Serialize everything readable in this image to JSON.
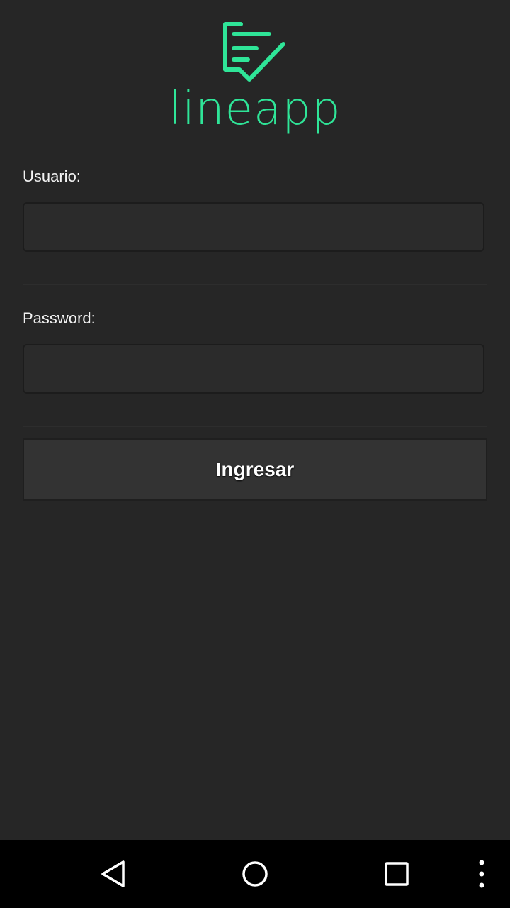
{
  "app": {
    "name": "lineapp",
    "accent_color": "#2fe598",
    "background_color": "#262626"
  },
  "form": {
    "username_label": "Usuario:",
    "username_value": "",
    "password_label": "Password:",
    "password_value": "",
    "submit_label": "Ingresar"
  },
  "navbar": {
    "buttons": [
      {
        "icon": "back-triangle-icon"
      },
      {
        "icon": "home-circle-icon"
      },
      {
        "icon": "recents-square-icon"
      },
      {
        "icon": "overflow-menu-icon"
      }
    ]
  }
}
